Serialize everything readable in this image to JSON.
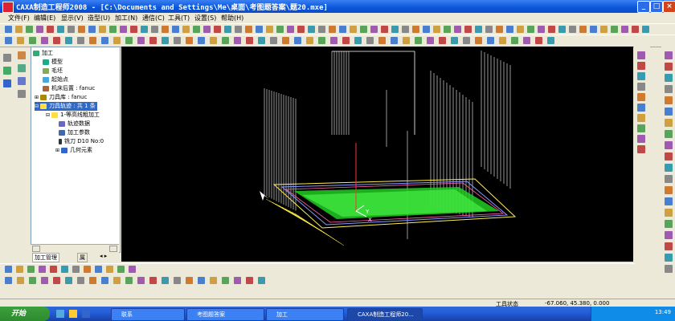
{
  "window": {
    "title": "CAXA制造工程师2008 - [C:\\Documents and Settings\\Me\\桌面\\考图题答案\\题20.mxe]"
  },
  "menu": [
    "文件(F)",
    "编辑(E)",
    "显示(V)",
    "造型(U)",
    "加工(N)",
    "通信(C)",
    "工具(T)",
    "设置(S)",
    "帮助(H)"
  ],
  "tree": {
    "root": "加工",
    "items": [
      "模型",
      "毛坯",
      "起始点",
      "机床后置 : fanuc",
      "刀具库 : fanuc",
      "刀具轨迹 : 共 1 条",
      "1-等高线粗加工",
      "轨迹数据",
      "加工参数",
      "铣刀 D10 No:0",
      "几何元素"
    ]
  },
  "panel_tabs": [
    "加工管理",
    "属"
  ],
  "status": {
    "left": "工具状态",
    "coords": "-67.060, 45.380, 0.000"
  },
  "taskbar": {
    "start": "开始",
    "items": [
      "联系",
      "考图题答案",
      "加工",
      "CAXA制造工程师20..."
    ],
    "clock": "13:49"
  },
  "colors": {
    "titlebar": "#0a56d8",
    "viewport": "#000000",
    "toolpath_green": "#22dd22",
    "wire_white": "#ffffff"
  }
}
